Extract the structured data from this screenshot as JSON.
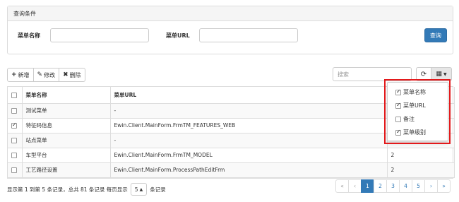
{
  "query": {
    "title": "查询条件",
    "menu_name_label": "菜单名称",
    "menu_name_value": "",
    "menu_url_label": "菜单URL",
    "menu_url_value": "",
    "search_button": "查询"
  },
  "toolbar": {
    "add_label": "新增",
    "edit_label": "修改",
    "delete_label": "删除",
    "search_placeholder": "搜索"
  },
  "table": {
    "headers": [
      "菜单名称",
      "菜单URL",
      ""
    ],
    "rows": [
      {
        "checked": false,
        "name": "测试菜单",
        "url": "-",
        "level": ""
      },
      {
        "checked": true,
        "name": "特征码信息",
        "url": "Ewin.Client.MainForm.FrmTM_FEATURES_WEB",
        "level": ""
      },
      {
        "checked": false,
        "name": "站点菜单",
        "url": "-",
        "level": ""
      },
      {
        "checked": false,
        "name": "车型平台",
        "url": "Ewin.Client.MainForm.FrmTM_MODEL",
        "level": "2"
      },
      {
        "checked": false,
        "name": "工艺路径设置",
        "url": "Ewin.Client.MainForm.ProcessPathEditFrm",
        "level": "2"
      }
    ]
  },
  "columns_menu": [
    {
      "label": "菜单名称",
      "checked": true
    },
    {
      "label": "菜单URL",
      "checked": true
    },
    {
      "label": "备注",
      "checked": false
    },
    {
      "label": "菜单级别",
      "checked": true
    }
  ],
  "footer": {
    "summary": "显示第 1 到第 5 条记录，总共 81 条记录 每页显示",
    "page_size": "5",
    "suffix": "条记录"
  },
  "pagination": [
    "«",
    "‹",
    "1",
    "2",
    "3",
    "4",
    "5",
    "›",
    "»"
  ],
  "accent": "#337ab7",
  "highlight_color": "#e31a1c"
}
